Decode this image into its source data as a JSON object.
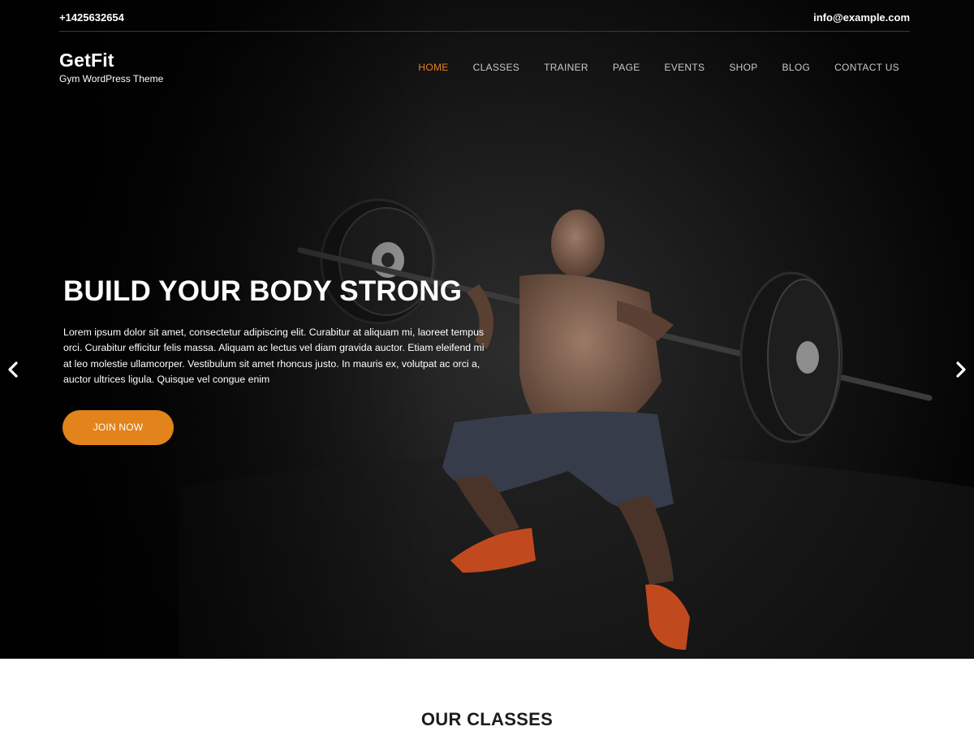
{
  "topbar": {
    "phone": "+1425632654",
    "email": "info@example.com"
  },
  "brand": {
    "logo": "GetFit",
    "tagline": "Gym WordPress Theme"
  },
  "nav": {
    "items": [
      {
        "label": "HOME",
        "active": true
      },
      {
        "label": "CLASSES",
        "active": false
      },
      {
        "label": "TRAINER",
        "active": false
      },
      {
        "label": "PAGE",
        "active": false
      },
      {
        "label": "EVENTS",
        "active": false
      },
      {
        "label": "SHOP",
        "active": false
      },
      {
        "label": "BLOG",
        "active": false
      },
      {
        "label": "CONTACT US",
        "active": false
      }
    ]
  },
  "hero": {
    "title": "BUILD YOUR BODY STRONG",
    "text": "Lorem ipsum dolor sit amet, consectetur adipiscing elit. Curabitur at aliquam mi, laoreet tempus orci. Curabitur efficitur felis massa. Aliquam ac lectus vel diam gravida auctor. Etiam eleifend mi at leo molestie ullamcorper. Vestibulum sit amet rhoncus justo. In mauris ex, volutpat ac orci a, auctor ultrices ligula. Quisque vel congue enim",
    "button_label": "JOIN NOW",
    "prev_icon": "chevron-left-icon",
    "next_icon": "chevron-right-icon"
  },
  "section": {
    "title": "OUR CLASSES"
  },
  "colors": {
    "accent": "#e8831f",
    "button": "#e3831b",
    "hero_bg": "#040404"
  }
}
